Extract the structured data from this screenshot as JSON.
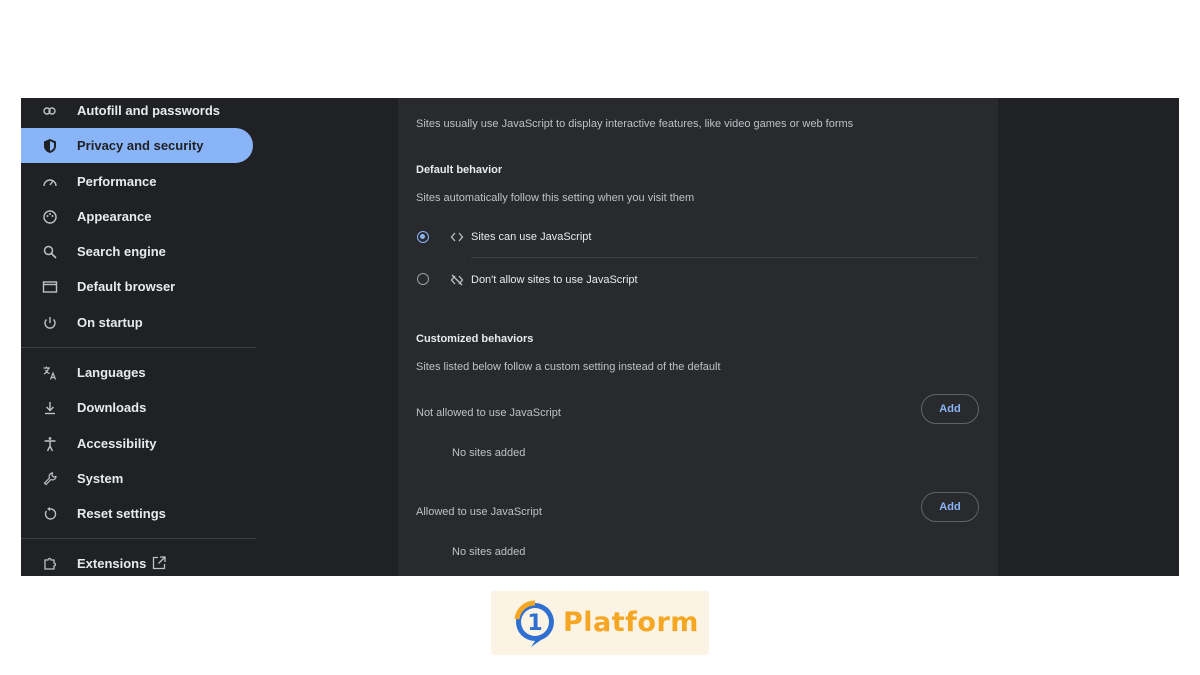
{
  "sidebar": {
    "items": [
      {
        "label": "Autofill and passwords",
        "icon": "key-icon"
      },
      {
        "label": "Privacy and security",
        "icon": "shield-icon",
        "active": true
      },
      {
        "label": "Performance",
        "icon": "speedometer-icon"
      },
      {
        "label": "Appearance",
        "icon": "palette-icon"
      },
      {
        "label": "Search engine",
        "icon": "search-icon"
      },
      {
        "label": "Default browser",
        "icon": "browser-window-icon"
      },
      {
        "label": "On startup",
        "icon": "power-icon"
      },
      {
        "label": "Languages",
        "icon": "translate-icon"
      },
      {
        "label": "Downloads",
        "icon": "download-icon"
      },
      {
        "label": "Accessibility",
        "icon": "accessibility-icon"
      },
      {
        "label": "System",
        "icon": "wrench-icon"
      },
      {
        "label": "Reset settings",
        "icon": "reset-icon"
      },
      {
        "label": "Extensions",
        "icon": "puzzle-icon",
        "trailing_icon": "open-external-icon"
      }
    ]
  },
  "main": {
    "intro": "Sites usually use JavaScript to display interactive features, like video games or web forms",
    "default_behavior": {
      "heading": "Default behavior",
      "description": "Sites automatically follow this setting when you visit them",
      "options": [
        {
          "label": "Sites can use JavaScript",
          "icon": "code-icon",
          "selected": true
        },
        {
          "label": "Don't allow sites to use JavaScript",
          "icon": "code-off-icon",
          "selected": false
        }
      ]
    },
    "customized": {
      "heading": "Customized behaviors",
      "description": "Sites listed below follow a custom setting instead of the default",
      "not_allowed": {
        "label": "Not allowed to use JavaScript",
        "button": "Add",
        "empty": "No sites added"
      },
      "allowed": {
        "label": "Allowed to use JavaScript",
        "button": "Add",
        "empty": "No sites added"
      }
    }
  },
  "logo": {
    "text": "Platform",
    "badge": "1"
  },
  "colors": {
    "accent": "#8ab4f8",
    "background": "#202124",
    "panel": "#292a2d",
    "logo_orange": "#f5a623",
    "logo_blue": "#2e6fd1"
  }
}
